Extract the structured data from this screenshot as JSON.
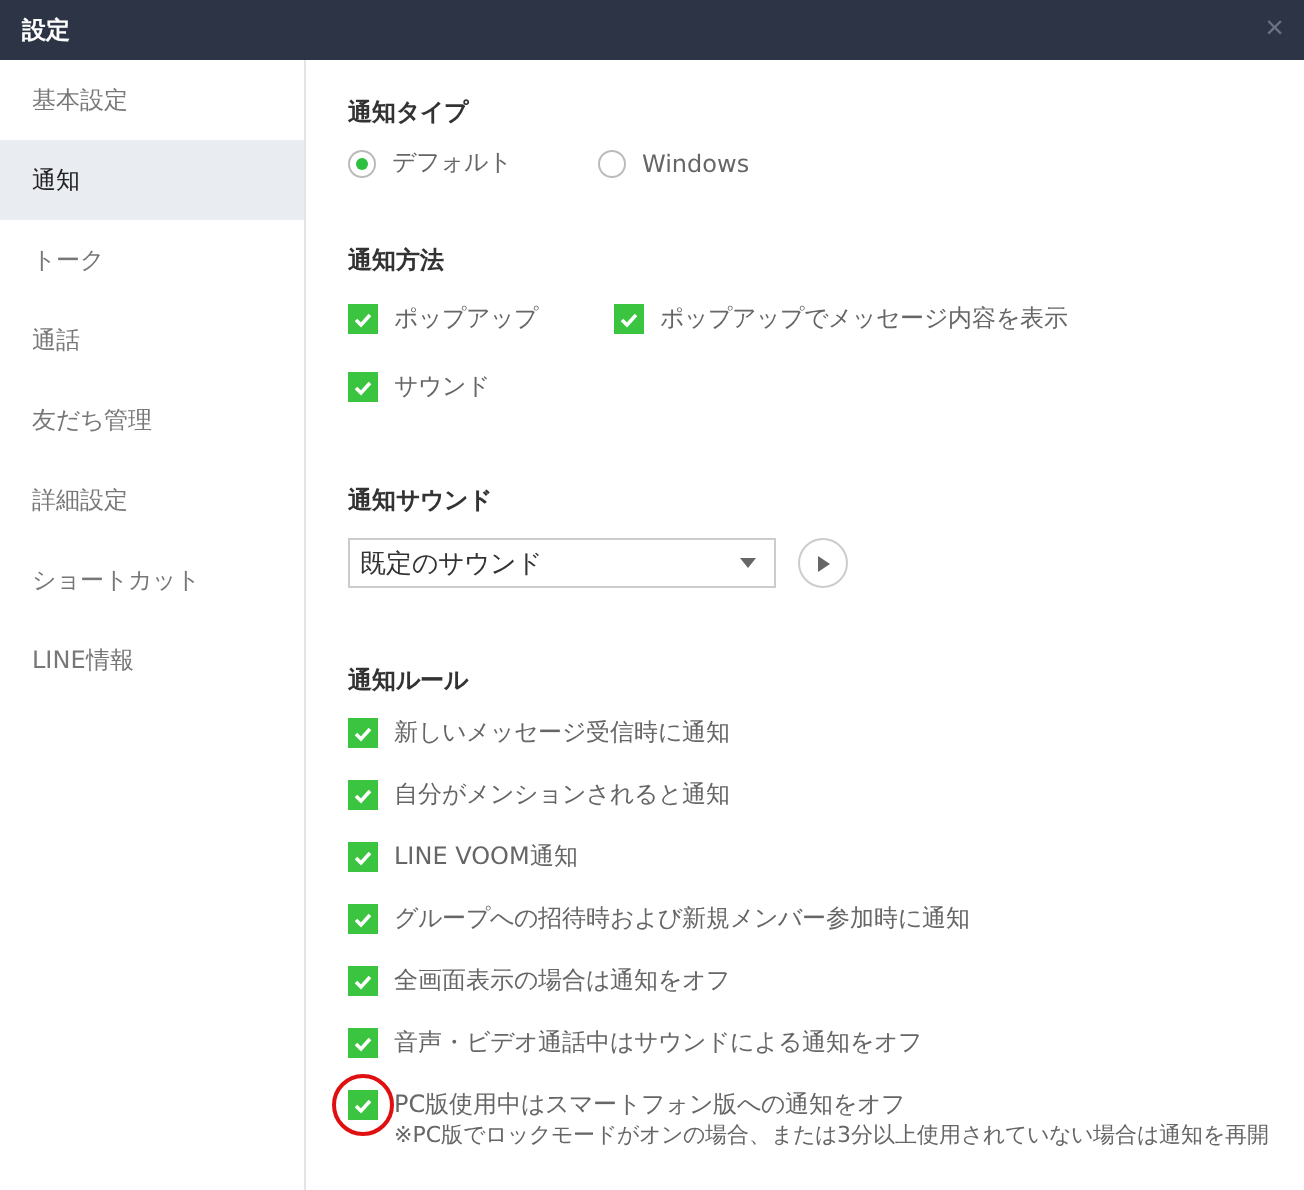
{
  "window": {
    "title": "設定",
    "close": "×"
  },
  "sidebar": {
    "items": [
      {
        "label": "基本設定",
        "selected": false
      },
      {
        "label": "通知",
        "selected": true
      },
      {
        "label": "トーク",
        "selected": false
      },
      {
        "label": "通話",
        "selected": false
      },
      {
        "label": "友だち管理",
        "selected": false
      },
      {
        "label": "詳細設定",
        "selected": false
      },
      {
        "label": "ショートカット",
        "selected": false
      },
      {
        "label": "LINE情報",
        "selected": false
      }
    ]
  },
  "notification_type": {
    "heading": "通知タイプ",
    "options": [
      {
        "label": "デフォルト",
        "selected": true
      },
      {
        "label": "Windows",
        "selected": false
      }
    ]
  },
  "notification_method": {
    "heading": "通知方法",
    "options": [
      {
        "label": "ポップアップ",
        "checked": true
      },
      {
        "label": "ポップアップでメッセージ内容を表示",
        "checked": true
      },
      {
        "label": "サウンド",
        "checked": true
      }
    ]
  },
  "notification_sound": {
    "heading": "通知サウンド",
    "value": "既定のサウンド"
  },
  "notification_rules": {
    "heading": "通知ルール",
    "rules": [
      {
        "label": "新しいメッセージ受信時に通知",
        "checked": true,
        "highlighted": false
      },
      {
        "label": "自分がメンションされると通知",
        "checked": true,
        "highlighted": false
      },
      {
        "label": "LINE VOOM通知",
        "checked": true,
        "highlighted": false
      },
      {
        "label": "グループへの招待時および新規メンバー参加時に通知",
        "checked": true,
        "highlighted": false
      },
      {
        "label": "全画面表示の場合は通知をオフ",
        "checked": true,
        "highlighted": false
      },
      {
        "label": "音声・ビデオ通話中はサウンドによる通知をオフ",
        "checked": true,
        "highlighted": false
      },
      {
        "label": "PC版使用中はスマートフォン版への通知をオフ",
        "note": "※PC版でロックモードがオンの場合、または3分以上使用されていない場合は通知を再開",
        "checked": true,
        "highlighted": true
      }
    ]
  }
}
